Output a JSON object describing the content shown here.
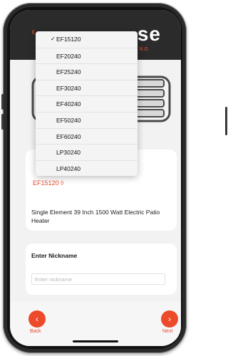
{
  "header": {
    "back_icon": "chevron-left-icon",
    "logo_partial": "se",
    "subtitle_partial": "NG"
  },
  "dropdown": {
    "selected": "EF15120",
    "options": [
      "EF15120",
      "EF20240",
      "EF25240",
      "EF30240",
      "EF40240",
      "EF50240",
      "EF60240",
      "LP30240",
      "LP40240"
    ]
  },
  "product": {
    "model_select": "EF15120 ◊",
    "description": "Single Element 39 Inch 1500 Watt Electric Patio Heater"
  },
  "nickname": {
    "title": "Enter Nickname",
    "placeholder": "Enter nickname",
    "value": ""
  },
  "footer": {
    "back_label": "Back",
    "next_label": "Next",
    "back_icon": "chevron-left-icon",
    "next_icon": "chevron-right-icon"
  },
  "colors": {
    "accent": "#ec4a2a",
    "header_bg": "#2b2b2b",
    "screen_bg": "#f2f2f2"
  }
}
